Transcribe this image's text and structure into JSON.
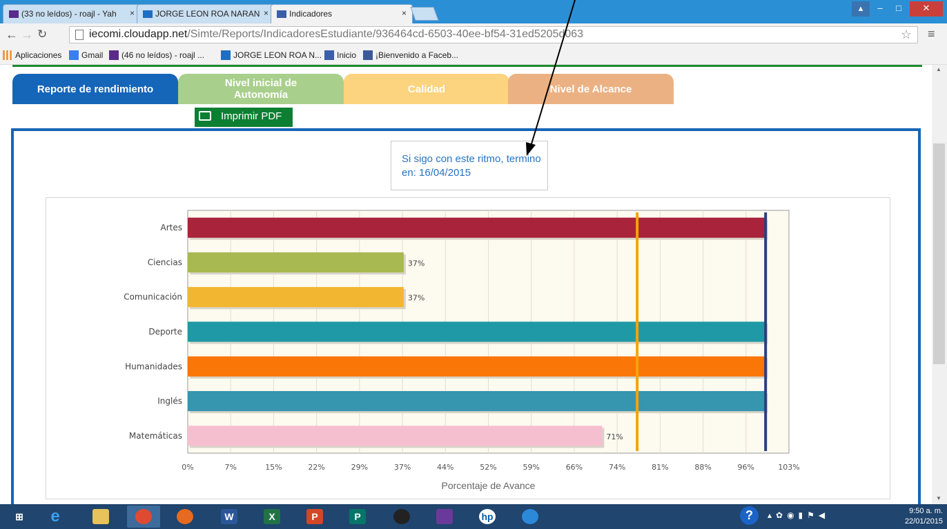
{
  "browser": {
    "tabs": [
      {
        "title": "(33 no leídos) - roajl - Yah",
        "icon": "mail-icon",
        "active": false
      },
      {
        "title": "JORGE LEON ROA NARAN",
        "icon": "outlook-icon",
        "active": false
      },
      {
        "title": "Indicadores",
        "icon": "site-icon",
        "active": true
      }
    ],
    "url_host": "iecomi.cloudapp.net",
    "url_path": "/Simte/Reports/IndicadoresEstudiante/936464cd-6503-40ee-bf54-31ed5205d063",
    "bookmarks": [
      {
        "label": "Aplicaciones",
        "icon": "apps-grid-icon"
      },
      {
        "label": "Gmail",
        "icon": "google-icon"
      },
      {
        "label": "(46 no leídos) - roajl ...",
        "icon": "mail-icon"
      },
      {
        "label": "JORGE LEON ROA N...",
        "icon": "outlook-icon"
      },
      {
        "label": "Inicio",
        "icon": "site-icon"
      },
      {
        "label": "¡Bienvenido a Faceb...",
        "icon": "facebook-icon"
      }
    ]
  },
  "page": {
    "tabs": [
      {
        "label": "Reporte de rendimiento",
        "color": "#1565b8"
      },
      {
        "label": "Nivel inicial de Autonomía",
        "color": "#a9cf8c"
      },
      {
        "label": "Calidad",
        "color": "#fcd37e"
      },
      {
        "label": "Nivel de Alcance",
        "color": "#ecb182"
      }
    ],
    "print_button": "Imprimir PDF",
    "note": "Si sigo con este ritmo, termino en: 16/04/2015"
  },
  "chart_data": {
    "type": "bar",
    "orientation": "horizontal",
    "categories": [
      "Artes",
      "Ciencias",
      "Comunicación",
      "Deporte",
      "Humanidades",
      "Inglés",
      "Matemáticas"
    ],
    "values": [
      99,
      37,
      37,
      99,
      99,
      99,
      71
    ],
    "value_labels": [
      "",
      "37%",
      "37%",
      "",
      "",
      "",
      "71%"
    ],
    "colors": [
      "#a9233b",
      "#a8b952",
      "#f2b630",
      "#2099a6",
      "#fa7606",
      "#3695af",
      "#f6bfd0"
    ],
    "xlabel": "Porcentaje de Avance",
    "xticks": [
      "0%",
      "7%",
      "15%",
      "22%",
      "29%",
      "37%",
      "44%",
      "52%",
      "59%",
      "66%",
      "74%",
      "81%",
      "88%",
      "96%",
      "103%"
    ],
    "xlim": [
      0,
      103
    ],
    "reference_lines": [
      {
        "value": 77,
        "color": "#f5a30b"
      },
      {
        "value": 99,
        "color": "#2b3f7e"
      }
    ],
    "grid": true
  },
  "taskbar": {
    "apps": [
      "start-icon",
      "ie-icon",
      "explorer-icon",
      "chrome-icon",
      "firefox-icon",
      "word-icon",
      "excel-icon",
      "powerpoint-icon",
      "publisher-icon",
      "camera-icon",
      "app-icon",
      "hp-icon",
      "security-icon"
    ],
    "time": "9:50 a. m.",
    "date": "22/01/2015"
  }
}
